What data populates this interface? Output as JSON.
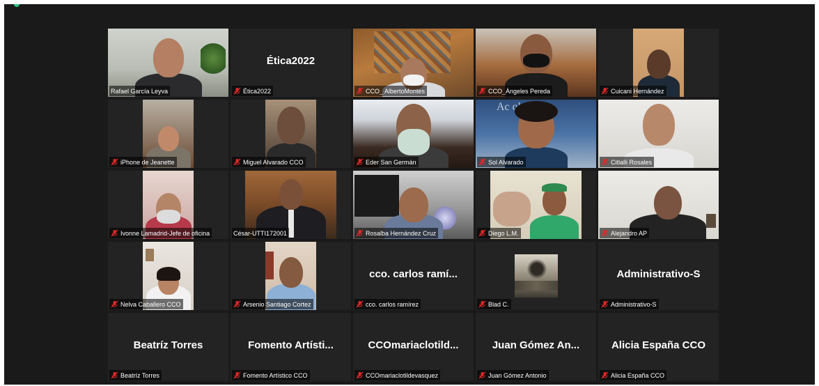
{
  "gallery": {
    "tiles": [
      {
        "name": "Rafael García Leyva",
        "display": ""
      },
      {
        "name": "Ética2022",
        "display": "Ética2022"
      },
      {
        "name": "CCO_ AlbertoMontes",
        "display": ""
      },
      {
        "name": "CCO_Ángeles Pereda",
        "display": ""
      },
      {
        "name": "Cuicani Hernández",
        "display": ""
      },
      {
        "name": "iPhone de Jeanette",
        "display": ""
      },
      {
        "name": "Miguel Alvarado CCO",
        "display": ""
      },
      {
        "name": "Eder San Germán",
        "display": ""
      },
      {
        "name": "Sol Alvarado",
        "display": ""
      },
      {
        "name": "Citlalli Rosales",
        "display": ""
      },
      {
        "name": "Ivonne Lamadrid-Jefe de oficina",
        "display": ""
      },
      {
        "name": "César-UTTI172001",
        "display": ""
      },
      {
        "name": "Rosalba Hernández Cruz",
        "display": ""
      },
      {
        "name": "Diego L.M.",
        "display": ""
      },
      {
        "name": "Alejandro AP",
        "display": ""
      },
      {
        "name": "Nelva Caballero CCO",
        "display": ""
      },
      {
        "name": "Arsenio Santiago Cortez",
        "display": ""
      },
      {
        "name": "cco. carlos ramírez",
        "display": "cco. carlos ramí..."
      },
      {
        "name": "Blad C.",
        "display": ""
      },
      {
        "name": "Administrativo-S",
        "display": "Administrativo-S"
      },
      {
        "name": "Beatríz Torres",
        "display": "Beatríz Torres"
      },
      {
        "name": "Fomento Artístico CCO",
        "display": "Fomento Artísti..."
      },
      {
        "name": "CCOmariaclotildevasquez",
        "display": "CCOmariaclotild..."
      },
      {
        "name": "Juan Gómez Antonio",
        "display": "Juan Gómez An..."
      },
      {
        "name": "Alicia España CCO",
        "display": "Alicia España CCO"
      }
    ]
  },
  "colors": {
    "background": "#1a1a1a",
    "tile": "#232323",
    "active_speaker": "#b7e34a",
    "muted_icon": "#e02828"
  },
  "icons": {
    "muted": "microphone-muted-icon"
  }
}
